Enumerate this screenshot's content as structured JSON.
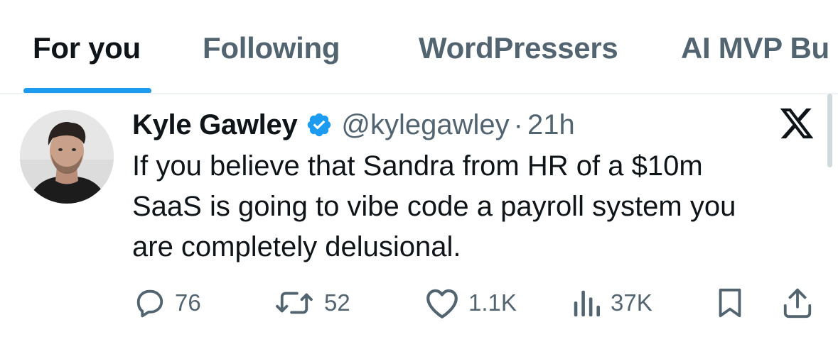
{
  "tabs": [
    {
      "label": "For you",
      "active": true
    },
    {
      "label": "Following",
      "active": false
    },
    {
      "label": "WordPressers",
      "active": false
    },
    {
      "label": "AI MVP Bu",
      "active": false
    }
  ],
  "tweet": {
    "author_name": "Kyle Gawley",
    "verified": true,
    "handle": "@kylegawley",
    "separator": "·",
    "time": "21h",
    "text": "If you believe that Sandra from HR of a $10m\nSaaS is going to vibe code a payroll system you\nare completely delusional.",
    "platform_icon": "x-logo-icon",
    "avatar_icon": "profile-photo"
  },
  "actions": {
    "replies": {
      "icon": "reply-icon",
      "count": "76"
    },
    "reposts": {
      "icon": "repost-icon",
      "count": "52"
    },
    "likes": {
      "icon": "heart-icon",
      "count": "1.1K"
    },
    "views": {
      "icon": "analytics-icon",
      "count": "37K"
    },
    "bookmark": {
      "icon": "bookmark-icon"
    },
    "share": {
      "icon": "share-icon"
    }
  },
  "colors": {
    "accent": "#1d9bf0",
    "text_primary": "#0f1419",
    "text_secondary": "#536471",
    "divider": "#eff3f4"
  }
}
